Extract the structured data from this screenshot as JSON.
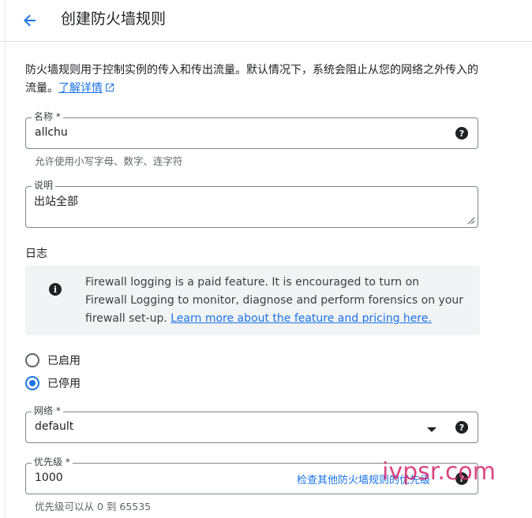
{
  "header": {
    "title": "创建防火墙规则"
  },
  "intro": {
    "text": "防火墙规则用于控制实例的传入和传出流量。默认情况下，系统会阻止从您的网络之外传入的流量。",
    "link": "了解详情"
  },
  "name_field": {
    "label": "名称 *",
    "value": "allchu",
    "hint": "允许使用小写字母、数字、连字符"
  },
  "description_field": {
    "label": "说明",
    "value": "出站全部"
  },
  "logs": {
    "heading": "日志",
    "info_text": "Firewall logging is a paid feature. It is encouraged to turn on Firewall Logging to monitor, diagnose and perform forensics on your firewall set-up.",
    "info_link": "Learn more about the feature and pricing here.",
    "options": [
      "已启用",
      "已停用"
    ],
    "selected": "已停用"
  },
  "network_field": {
    "label": "网络 *",
    "value": "default"
  },
  "priority_field": {
    "label": "优先级 *",
    "value": "1000",
    "link": "检查其他防火墙规则的优先级",
    "hint": "优先级可以从 0 到 65535"
  },
  "watermark": "ivpsr.com",
  "colors": {
    "accent": "#1a73e8",
    "watermark": "#d6286e"
  }
}
